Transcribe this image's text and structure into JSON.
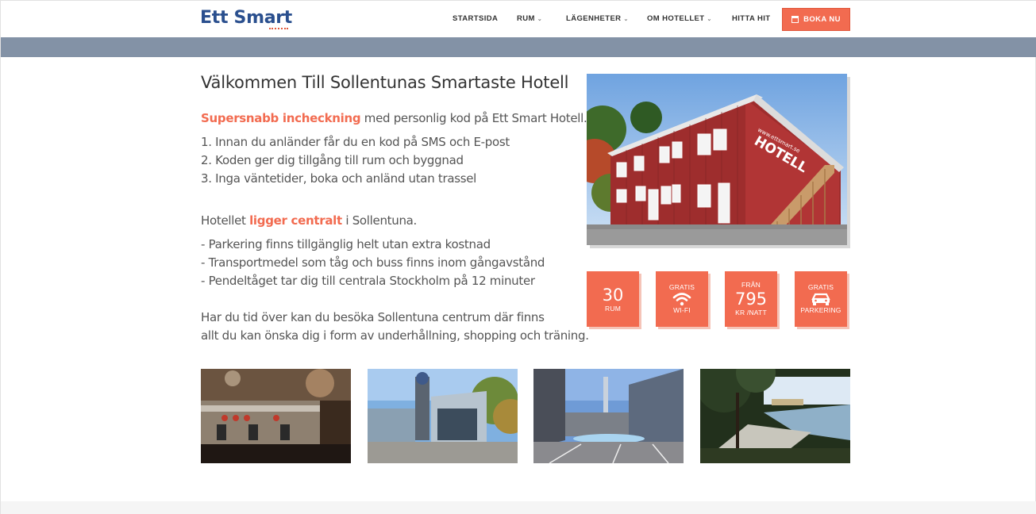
{
  "header": {
    "logo": "Ett Smart",
    "nav": [
      {
        "label": "STARTSIDA",
        "dropdown": false
      },
      {
        "label": "RUM",
        "dropdown": true
      },
      {
        "label": "LÄGENHETER",
        "dropdown": true
      },
      {
        "label": "OM HOTELLET",
        "dropdown": true
      },
      {
        "label": "HITTA HIT",
        "dropdown": false
      }
    ],
    "book_button": "BOKA NU",
    "book_icon": "calendar-icon"
  },
  "main": {
    "title": "Välkommen Till Sollentunas Smartaste Hotell",
    "intro": {
      "highlight": "Supersnabb incheckning",
      "rest": " med personlig kod på Ett Smart Hotell."
    },
    "steps": [
      "1. Innan du anländer får du en kod på SMS och E-post",
      "2. Koden ger dig tillgång till rum och byggnad",
      "3. Inga väntetider, boka och anländ utan trassel"
    ],
    "location": {
      "pre": "Hotellet ",
      "highlight": "ligger centralt",
      "post": " i Sollentuna."
    },
    "bullets": [
      "- Parkering finns tillgänglig helt utan extra kostnad",
      "- Transportmedel som tåg och buss finns inom gångavstånd",
      "- Pendeltåget tar dig till centrala Stockholm på 12 minuter"
    ],
    "outro": [
      "Har du tid över kan du besöka Sollentuna centrum där finns",
      "allt du kan önska dig i form av underhållning, shopping och träning."
    ]
  },
  "photo": {
    "sign": "HOTELL",
    "sign_small": "www.ettsmart.se"
  },
  "features": [
    {
      "top": "",
      "value": "30",
      "bottom": "RUM",
      "icon": ""
    },
    {
      "top": "GRATIS",
      "value": "",
      "bottom": "WI-FI",
      "icon": "wifi-icon"
    },
    {
      "top": "FRÅN",
      "value": "795",
      "bottom": "KR /NATT",
      "icon": ""
    },
    {
      "top": "GRATIS",
      "value": "",
      "bottom": "PARKERING",
      "icon": "car-icon"
    }
  ],
  "colors": {
    "accent": "#f26b50",
    "logo": "#2a4f8e",
    "banner": "#8392a6"
  }
}
